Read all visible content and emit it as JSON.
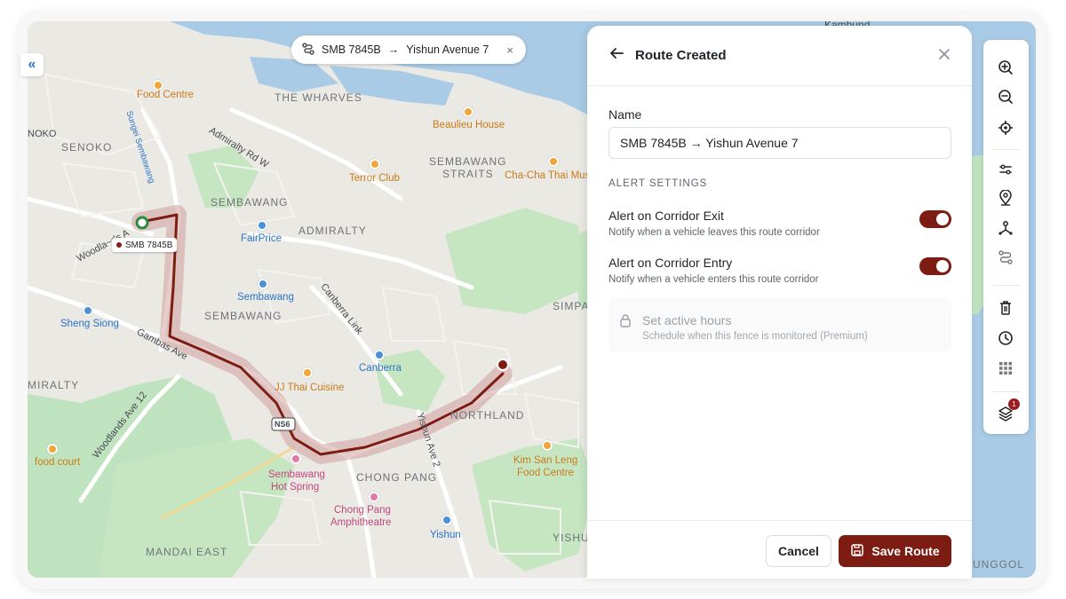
{
  "map": {
    "back_glyph": "«",
    "route_pill": {
      "icon": "route-icon",
      "vehicle": "SMB 7845B",
      "arrow": "→",
      "destination": "Yishun Avenue 7",
      "close": "×"
    },
    "vehicle_tag": "SMB 7845B",
    "labels": {
      "food_centre": "Food Centre",
      "the_wharves": "THE WHARVES",
      "senoko": "SENOKO",
      "noko": "NOKO",
      "admiralty_rd_w": "Admiralty Rd W",
      "beaulieu_house": "Beaulieu House",
      "sembawang_straits_1": "SEMBAWANG",
      "sembawang_straits_2": "STRAITS",
      "terror_club": "Terror Club",
      "chacha": "Cha-Cha Thai Mus",
      "sungei": "Sungei Sembawang",
      "sembawang_area": "SEMBAWANG",
      "admiralty_area": "ADMIRALTY",
      "fairprice": "FairPrice",
      "woodlands_ave": "Woodla~ds A",
      "canberra_link": "Canberra Link",
      "sembawang_station": "Sembawang",
      "sembawang_area2": "SEMBAWANG",
      "simpang": "SIMPAN",
      "sheng_siong": "Sheng Siong",
      "gambas_ave": "Gambas Ave",
      "canberra_station": "Canberra",
      "miralty": "MIRALTY",
      "jj_thai": "JJ Thai Cuisine",
      "woodlands_ave12": "Woodlands Ave 12",
      "northland": "NORTHLAND",
      "yishun_ave2": "Yishun Ave 2",
      "ns_badge": "NS6",
      "food_court": "food court",
      "sembawang_hot_1": "Sembawang",
      "sembawang_hot_2": "Hot Spring",
      "chong_pang": "CHONG PANG",
      "kim_san_1": "Kim San Leng",
      "kim_san_2": "Food Centre",
      "chong_pang_amp_1": "Chong Pang",
      "chong_pang_amp_2": "Amphitheatre",
      "yishun_station": "Yishun",
      "mandai_east": "MANDAI EAST",
      "yishun_area": "YISHUN",
      "kambund": "Kambund",
      "unggol": "UNGGOL"
    }
  },
  "panel": {
    "title": "Route Created",
    "name_label": "Name",
    "name_value": "SMB 7845B → Yishun Avenue 7",
    "section_title": "ALERT SETTINGS",
    "alerts": [
      {
        "title": "Alert on Corridor Exit",
        "description": "Notify when a vehicle leaves this route corridor",
        "enabled": true
      },
      {
        "title": "Alert on Corridor Entry",
        "description": "Notify when a vehicle enters this route corridor",
        "enabled": true
      }
    ],
    "premium": {
      "title": "Set active hours",
      "description": "Schedule when this fence is monitored (Premium)"
    },
    "cancel_label": "Cancel",
    "save_label": "Save Route"
  },
  "toolbar": {
    "tools": [
      "zoom-in-icon",
      "zoom-out-icon",
      "locate-icon",
      "filter-icon",
      "pin-icon",
      "waypoint-icon",
      "route-icon",
      "trash-icon",
      "clock-icon",
      "grid-icon",
      "layers-icon"
    ],
    "layers_badge": "1"
  },
  "colors": {
    "accent": "#7c1c12",
    "water": "#a9cbe6",
    "park": "#bfe3be",
    "route": "#7c1c12"
  }
}
